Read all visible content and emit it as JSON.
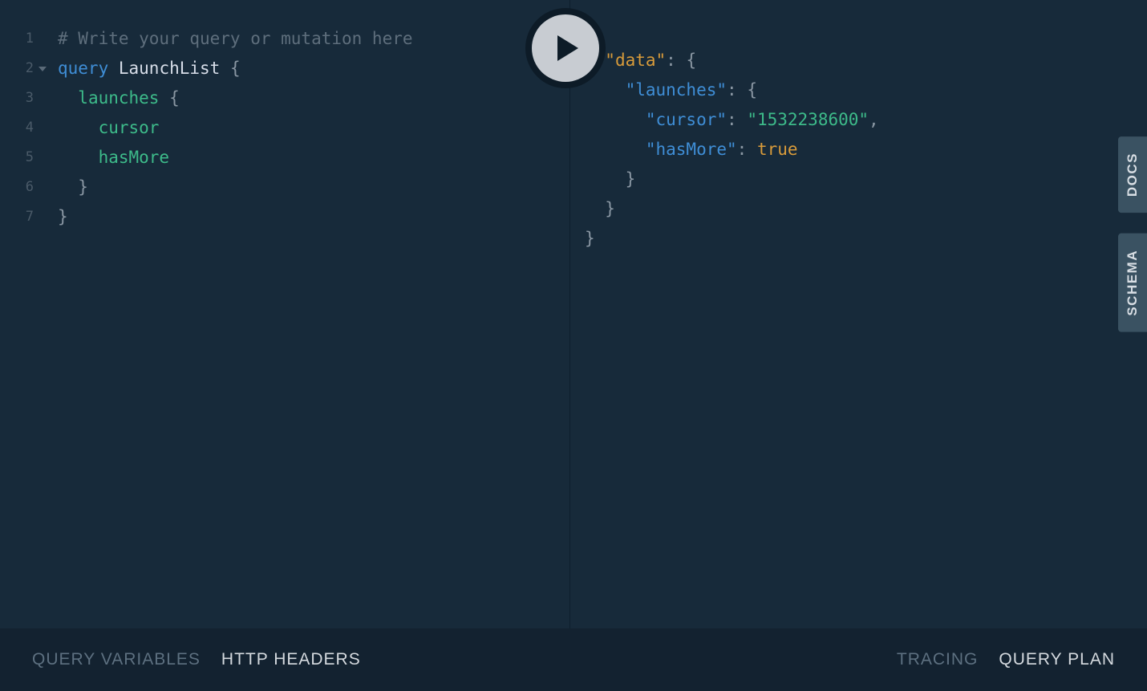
{
  "editor": {
    "lineNumbers": [
      "1",
      "2",
      "3",
      "4",
      "5",
      "6",
      "7"
    ],
    "comment": "# Write your query or mutation here",
    "keyword": "query",
    "operationName": "LaunchList",
    "field1": "launches",
    "field2": "cursor",
    "field3": "hasMore",
    "openBrace": "{",
    "closeBrace": "}"
  },
  "result": {
    "openBrace": "{",
    "dataKey": "\"data\"",
    "launchesKey": "\"launches\"",
    "cursorKey": "\"cursor\"",
    "cursorValue": "\"1532238600\"",
    "hasMoreKey": "\"hasMore\"",
    "hasMoreValue": "true",
    "colon": ":",
    "comma": ",",
    "closeBrace": "}"
  },
  "sideTabs": {
    "docs": "DOCS",
    "schema": "SCHEMA"
  },
  "footer": {
    "queryVariables": "QUERY VARIABLES",
    "httpHeaders": "HTTP HEADERS",
    "tracing": "TRACING",
    "queryPlan": "QUERY PLAN"
  }
}
